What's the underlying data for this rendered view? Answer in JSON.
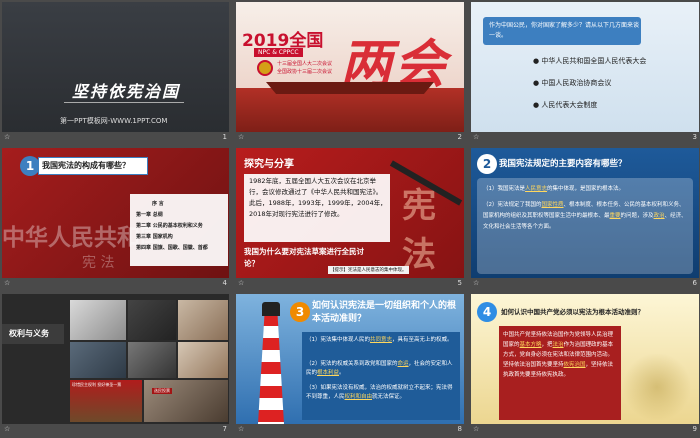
{
  "slides": [
    {
      "number": "1",
      "title": "坚持依宪治国",
      "subtitle": "第一PPT模板网-WWW.1PPT.COM"
    },
    {
      "number": "2",
      "banner_year": "2019全国",
      "banner_label": "NPC & CPPCC",
      "banner_line1": "十三届全国人大二次会议",
      "banner_line2": "全国政协十三届二次会议",
      "big_text": "两会"
    },
    {
      "number": "3",
      "question": "作为中国公民，你对国家了解多少？请从以下几方面来谈一谈。",
      "items": [
        "中华人民共和国全国人民代表大会",
        "中国人民政治协商会议",
        "人民代表大会制度"
      ]
    },
    {
      "number": "4",
      "header": "我国宪法的构成有哪些？",
      "badge": "1",
      "toc": [
        "序 言",
        "第一章 总纲",
        "第二章 公民的基本权利和义务",
        "第三章 国家机构",
        "第四章 国旗、国歌、国徽、首都"
      ],
      "bg_text": "中华人民共和国",
      "bg_text2": "宪 法"
    },
    {
      "number": "5",
      "title": "探究与分享",
      "body": "1982年底，五届全国人大五次会议在北京举行，会议修改通过了《中华人民共和国宪法》。此后，1988年，1993年，1999年，2004年，2018年对现行宪法进行了修改。",
      "question": "我国为什么要对宪法草案进行全民讨论？",
      "hint": "【提示】宪法是人民意志的集中体现。",
      "seal": "宪法"
    },
    {
      "number": "6",
      "badge": "2",
      "header": "我国宪法规定的主要内容有哪些？",
      "points": [
        {
          "pre": "（1）我国宪法是",
          "link": "人民意志",
          "post": "的集中体现，是国家的根本法。"
        },
        {
          "pre": "（2）宪法规定了我国的",
          "link": "国家性质",
          "post": "、根本制度、根本任务、公民的基本权利和义务、国家机构的组织及其职权等国家生活中的最根本、最",
          "link2": "重要",
          "post2": "的问题，涉及",
          "link3": "政治",
          "post3": "、经济、文化和社会生活等各个方面。"
        }
      ]
    },
    {
      "number": "7",
      "label": "权利与义务",
      "photo_sign": "珍惜民主权利 投好神圣一票",
      "photo_sign2": "选民投票"
    },
    {
      "number": "8",
      "badge": "3",
      "header": "如何认识宪法是一切组织和个人的根本活动准则？",
      "points": [
        {
          "pre": "（1）宪法集中体现人民的",
          "link": "共同意志",
          "post": "，具有至高无上的权威。"
        },
        {
          "pre": "（2）宪法的权威关系到政党和国家的",
          "link": "命运",
          "post": "，社会的安定和人民的",
          "link2": "根本利益",
          "post2": "。"
        },
        {
          "pre": "（3）如果宪法没有权威，法治的权威就树立不起来；宪法得不到尊重，人民",
          "link": "权利和自由",
          "post": "就无法保证。"
        }
      ]
    },
    {
      "number": "9",
      "badge": "4",
      "header": "如何认识中国共产党必须以宪法为根本活动准则？",
      "body_pre": "中国共产党坚持依法治国作为党领导人民治理国家的",
      "link1": "基本方略",
      "mid1": "，把",
      "link2": "法治",
      "mid2": "作为治国理政的基本方式，党自身必须在宪法和法律范围内活动。坚持依法治国首先要坚持",
      "link3": "依宪治国",
      "post": "，坚持依法执政首先要坚持依宪执政。"
    }
  ],
  "footer_star": "☆"
}
